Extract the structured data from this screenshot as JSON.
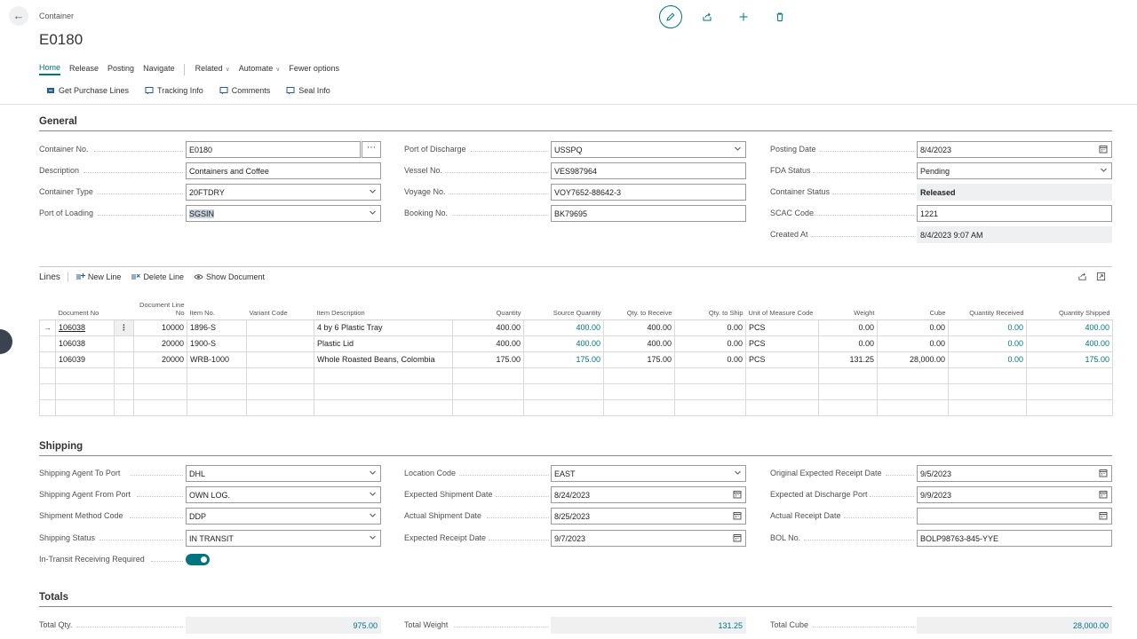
{
  "header": {
    "breadcrumb": "Container",
    "title": "E0180",
    "actions": [
      "edit-icon",
      "share-icon",
      "new-icon",
      "delete-icon"
    ]
  },
  "menu": {
    "items": [
      "Home",
      "Release",
      "Posting",
      "Navigate",
      "Related",
      "Automate",
      "Fewer options"
    ],
    "active": "Home"
  },
  "subactions": [
    "Get Purchase Lines",
    "Tracking Info",
    "Comments",
    "Seal Info"
  ],
  "general": {
    "title": "General",
    "col1": [
      {
        "label": "Container No.",
        "value": "E0180"
      },
      {
        "label": "Description",
        "value": "Containers and Coffee"
      },
      {
        "label": "Container Type",
        "value": "20FTDRY"
      },
      {
        "label": "Port of Loading",
        "value": "SGSIN"
      }
    ],
    "col2": [
      {
        "label": "Port of Discharge",
        "value": "USSPQ"
      },
      {
        "label": "Vessel No.",
        "value": "VES987964"
      },
      {
        "label": "Voyage No.",
        "value": "VOY7652-88642-3"
      },
      {
        "label": "Booking No.",
        "value": "BK79695"
      }
    ],
    "col3": [
      {
        "label": "Posting Date",
        "value": "8/4/2023"
      },
      {
        "label": "FDA Status",
        "value": "Pending"
      },
      {
        "label": "Container Status",
        "value": "Released"
      },
      {
        "label": "SCAC Code",
        "value": "1221"
      },
      {
        "label": "Created At",
        "value": "8/4/2023 9:07 AM"
      }
    ]
  },
  "lines": {
    "title": "Lines",
    "actions": [
      "New Line",
      "Delete Line",
      "Show Document"
    ],
    "columns": [
      "Document No",
      "Document Line No",
      "Item No.",
      "Variant Code",
      "Item Description",
      "Quantity",
      "Source Quantity",
      "Qty. to Receive",
      "Qty. to Ship",
      "Unit of Measure Code",
      "Weight",
      "Cube",
      "Quantity Received",
      "Quantity Shipped"
    ],
    "rows": [
      {
        "doc": "106038",
        "line": "10000",
        "item": "1896-S",
        "variant": "",
        "desc": "4 by 6 Plastic Tray",
        "qty": "400.00",
        "src": "400.00",
        "recv": "400.00",
        "ship": "0.00",
        "uom": "PCS",
        "weight": "0.00",
        "cube": "0.00",
        "received": "0.00",
        "shipped": "400.00"
      },
      {
        "doc": "106038",
        "line": "20000",
        "item": "1900-S",
        "variant": "",
        "desc": "Plastic Lid",
        "qty": "400.00",
        "src": "400.00",
        "recv": "400.00",
        "ship": "0.00",
        "uom": "PCS",
        "weight": "0.00",
        "cube": "0.00",
        "received": "0.00",
        "shipped": "400.00"
      },
      {
        "doc": "106039",
        "line": "20000",
        "item": "WRB-1000",
        "variant": "",
        "desc": "Whole Roasted Beans, Colombia",
        "qty": "175.00",
        "src": "175.00",
        "recv": "175.00",
        "ship": "0.00",
        "uom": "PCS",
        "weight": "131.25",
        "cube": "28,000.00",
        "received": "0.00",
        "shipped": "175.00"
      }
    ]
  },
  "shipping": {
    "title": "Shipping",
    "col1": [
      {
        "label": "Shipping Agent To Port",
        "value": "DHL"
      },
      {
        "label": "Shipping Agent From Port",
        "value": "OWN LOG."
      },
      {
        "label": "Shipment Method Code",
        "value": "DDP"
      },
      {
        "label": "Shipping Status",
        "value": "IN TRANSIT"
      }
    ],
    "toggle_label": "In-Transit Receiving Required",
    "toggle_on": true,
    "col2": [
      {
        "label": "Location Code",
        "value": "EAST"
      },
      {
        "label": "Expected Shipment Date",
        "value": "8/24/2023"
      },
      {
        "label": "Actual Shipment Date",
        "value": "8/25/2023"
      },
      {
        "label": "Expected Receipt Date",
        "value": "9/7/2023"
      }
    ],
    "col3": [
      {
        "label": "Original Expected Receipt Date",
        "value": "9/5/2023"
      },
      {
        "label": "Expected at Discharge Port",
        "value": "9/9/2023"
      },
      {
        "label": "Actual Receipt Date",
        "value": ""
      },
      {
        "label": "BOL No.",
        "value": "BOLP98763-845-YYE"
      }
    ]
  },
  "totals": {
    "title": "Totals",
    "items": [
      {
        "label": "Total Qty.",
        "value": "975.00"
      },
      {
        "label": "Total Weight",
        "value": "131.25"
      },
      {
        "label": "Total Cube",
        "value": "28,000.00"
      }
    ]
  },
  "colors": {
    "accent": "#00757f",
    "readonly_bg": "#eef0f2"
  }
}
